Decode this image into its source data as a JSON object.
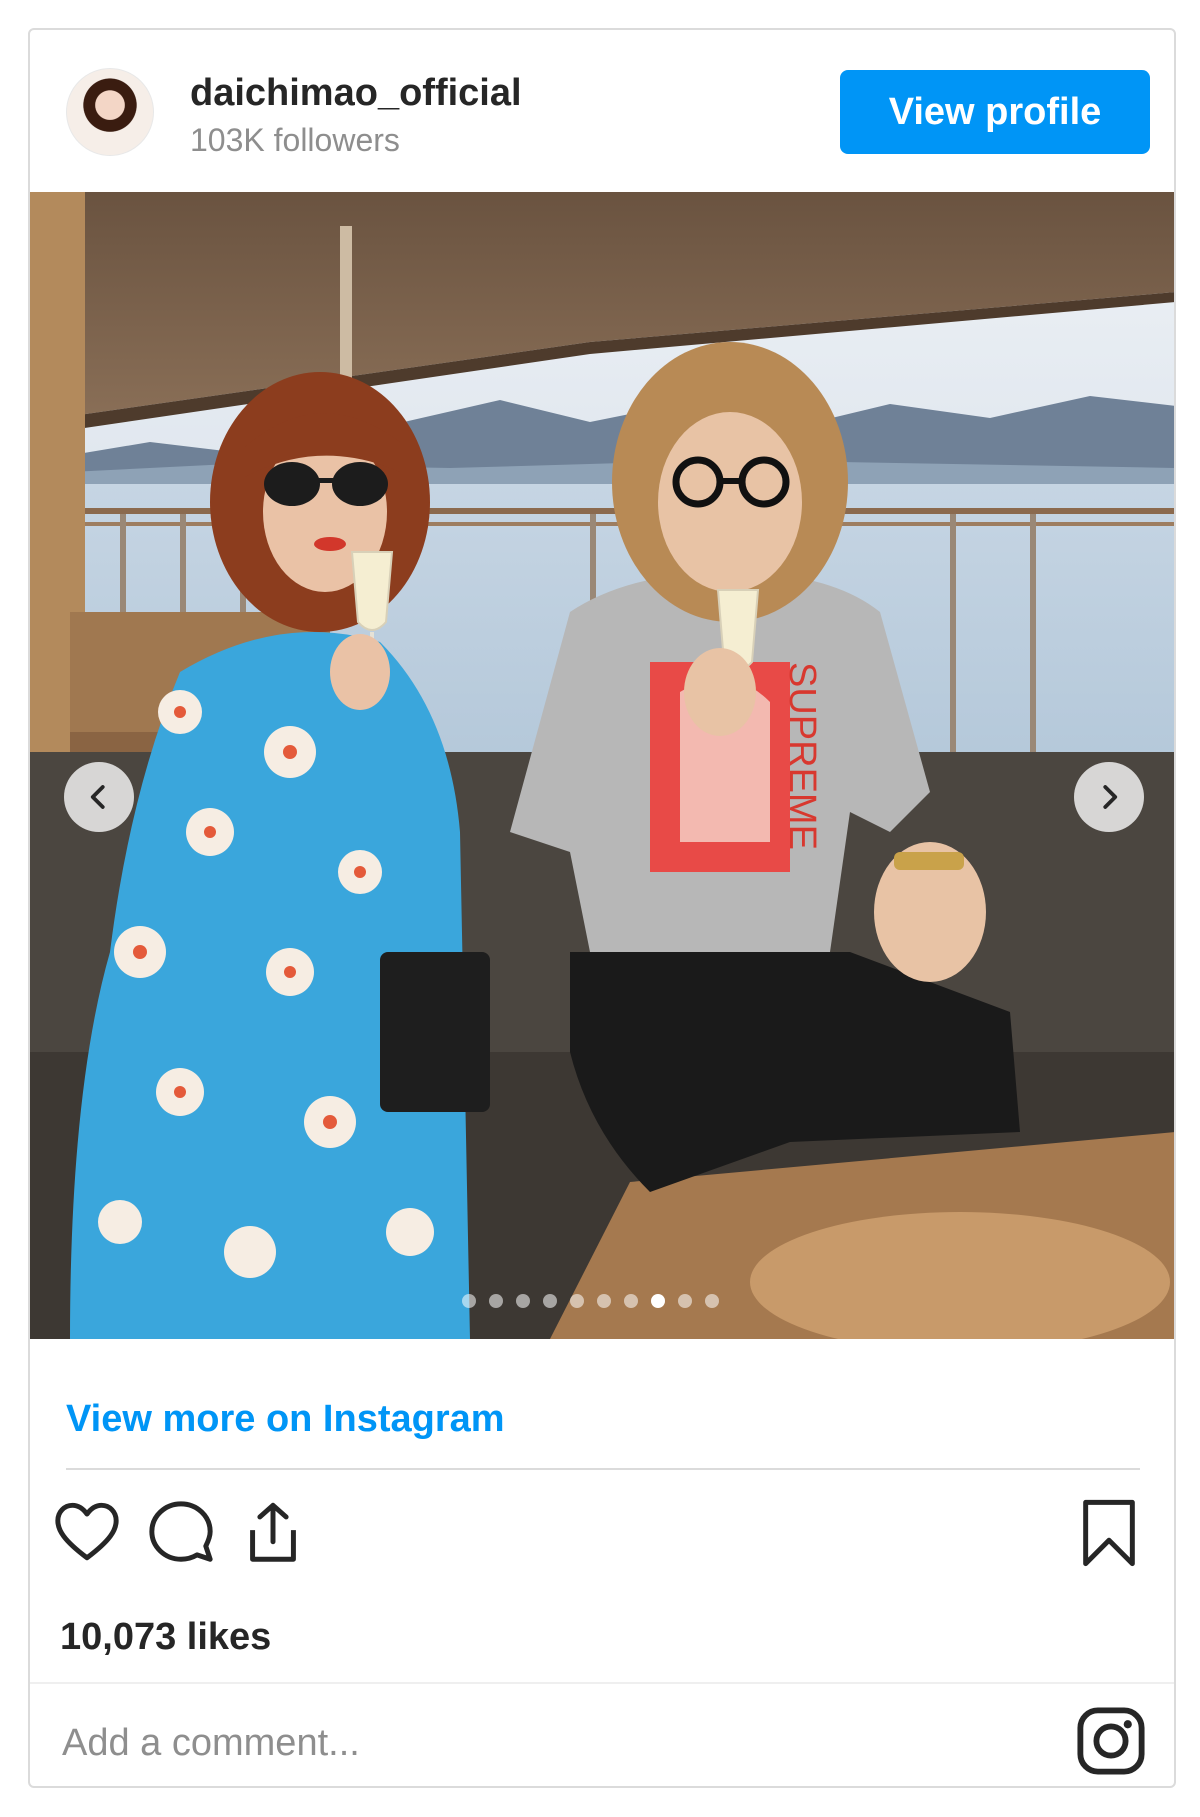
{
  "header": {
    "username": "daichimao_official",
    "followers": "103K followers",
    "view_profile_label": "View profile"
  },
  "carousel": {
    "prev_icon": "chevron-left-icon",
    "next_icon": "chevron-right-icon",
    "dot_count": 10,
    "active_dot_index": 7,
    "photo_text": "SUPREME"
  },
  "footer": {
    "view_more_label": "View more on Instagram",
    "likes": "10,073 likes",
    "comment_placeholder": "Add a comment...",
    "icons": [
      "heart-icon",
      "comment-icon",
      "share-icon",
      "bookmark-icon",
      "instagram-icon"
    ]
  },
  "colors": {
    "accent": "#0095f6",
    "text": "#262626",
    "muted": "#8e8e8e",
    "border": "#dbdbdb"
  }
}
